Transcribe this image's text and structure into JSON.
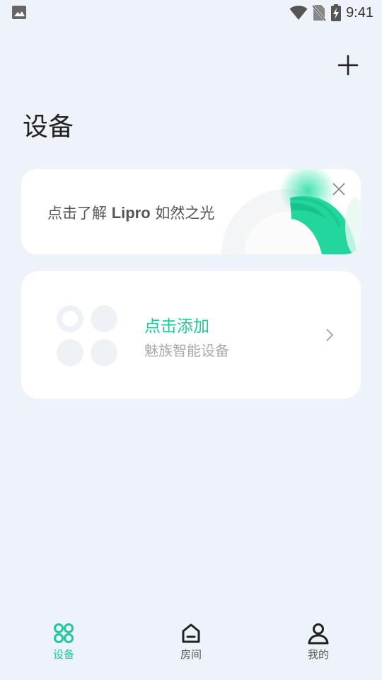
{
  "status_bar": {
    "time": "9:41"
  },
  "header": {
    "title": "设备"
  },
  "promo": {
    "text_prefix": "点击了解 ",
    "brand": "Lipro",
    "text_suffix": " 如然之光"
  },
  "add_device": {
    "title": "点击添加",
    "subtitle": "魅族智能设备"
  },
  "tabs": [
    {
      "label": "设备",
      "icon": "devices-grid-icon",
      "active": true
    },
    {
      "label": "房间",
      "icon": "home-icon",
      "active": false
    },
    {
      "label": "我的",
      "icon": "user-icon",
      "active": false
    }
  ],
  "colors": {
    "accent": "#1fc99a",
    "background": "#eef3fa",
    "card": "#ffffff"
  }
}
